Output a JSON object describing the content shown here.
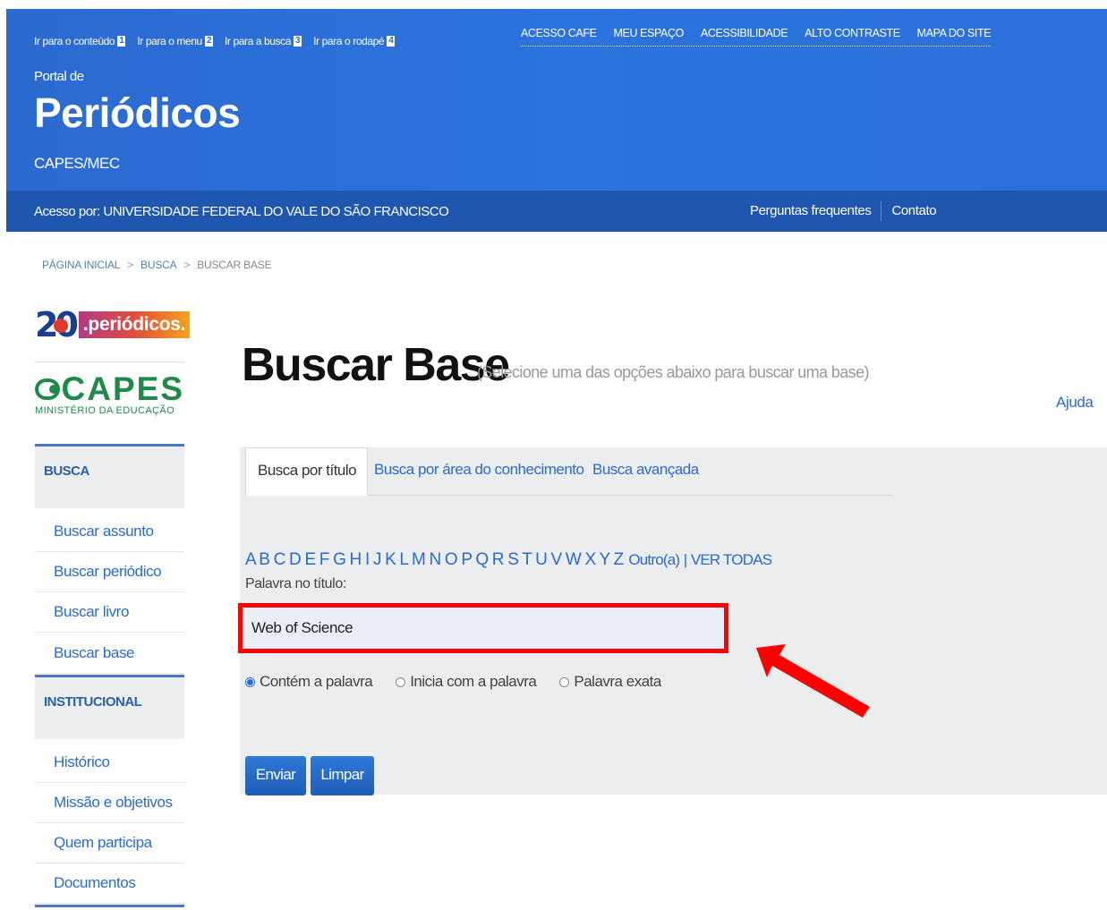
{
  "skip_links": [
    {
      "label": "Ir para o conteúdo",
      "key": "1"
    },
    {
      "label": "Ir para o menu",
      "key": "2"
    },
    {
      "label": "Ir para a busca",
      "key": "3"
    },
    {
      "label": "Ir para o rodapé",
      "key": "4"
    }
  ],
  "top_nav": [
    "ACESSO CAFE",
    "MEU ESPAÇO",
    "ACESSIBILIDADE",
    "ALTO CONTRASTE",
    "MAPA DO SITE"
  ],
  "portal": {
    "pre": "Portal de",
    "title": "Periódicos",
    "sub": "CAPES/MEC"
  },
  "access": {
    "text": "Acesso por: UNIVERSIDADE FEDERAL DO VALE DO SÃO FRANCISCO",
    "faq": "Perguntas frequentes",
    "contact": "Contato"
  },
  "breadcrumb": [
    "PÁGINA INICIAL",
    "BUSCA",
    "BUSCAR BASE"
  ],
  "breadcrumb_sep": ">",
  "logos": {
    "periodicos_num": "20",
    "periodicos_tag": ".periódicos.",
    "capes_word": "CAPES",
    "capes_sub": "MINISTÉRIO DA EDUCAÇÃO"
  },
  "sidebar": {
    "busca_head": "BUSCA",
    "busca_items": [
      "Buscar assunto",
      "Buscar periódico",
      "Buscar livro",
      "Buscar base"
    ],
    "inst_head": "INSTITUCIONAL",
    "inst_items": [
      "Histórico",
      "Missão e objetivos",
      "Quem participa",
      "Documentos"
    ]
  },
  "main": {
    "title": "Buscar Base",
    "subtitle": "(Selecione uma das opções abaixo para buscar uma base)",
    "help": "Ajuda",
    "tabs": [
      "Busca por título",
      "Busca por área do conhecimento",
      "Busca avançada"
    ],
    "letters": "A B C D E F G H I J K L M N O P Q R S T U V W X Y Z",
    "other": "Outro(a)",
    "separator": "|",
    "all": "VER TODAS",
    "field_label": "Palavra no título:",
    "field_value": "Web of Science",
    "options": [
      "Contém a palavra",
      "Inicia com a palavra",
      "Palavra exata"
    ],
    "selected_option": "Contém a palavra",
    "submit": "Enviar",
    "clear": "Limpar"
  },
  "colors": {
    "header_blue": "#2c70db",
    "access_bar": "#1f56b0",
    "highlight": "#ff0000",
    "link": "#2b6ad0"
  }
}
